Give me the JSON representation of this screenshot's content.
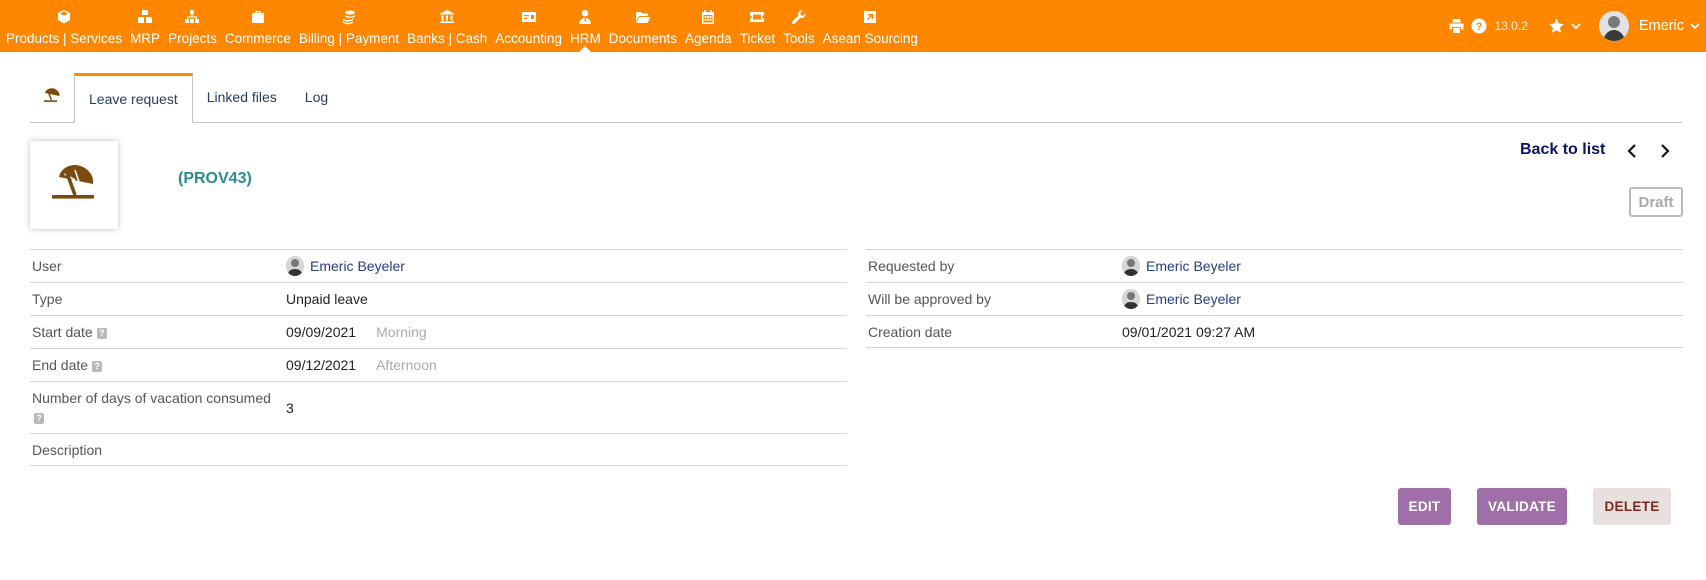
{
  "menu": [
    {
      "label": "Products | Services",
      "icon": "cube-icon"
    },
    {
      "label": "MRP",
      "icon": "cubes-icon"
    },
    {
      "label": "Projects",
      "icon": "sitemap-icon"
    },
    {
      "label": "Commerce",
      "icon": "briefcase-icon"
    },
    {
      "label": "Billing | Payment",
      "icon": "coins-icon"
    },
    {
      "label": "Banks | Cash",
      "icon": "bank-icon"
    },
    {
      "label": "Accounting",
      "icon": "money-check-icon"
    },
    {
      "label": "HRM",
      "icon": "user-tie-icon"
    },
    {
      "label": "Documents",
      "icon": "folder-open-icon"
    },
    {
      "label": "Agenda",
      "icon": "calendar-icon"
    },
    {
      "label": "Ticket",
      "icon": "ticket-icon"
    },
    {
      "label": "Tools",
      "icon": "wrench-icon"
    },
    {
      "label": "Asean Sourcing",
      "icon": "external-link-icon"
    }
  ],
  "active_menu": "HRM",
  "topright": {
    "version": "13.0.2",
    "user_name": "Emeric"
  },
  "tabs": {
    "icon": "beach-umbrella-icon",
    "items": [
      "Leave request",
      "Linked files",
      "Log"
    ],
    "active": "Leave request"
  },
  "header": {
    "ref": "(PROV43)",
    "back_to_list": "Back to list",
    "status": "Draft",
    "logo_icon": "beach-umbrella-icon"
  },
  "left_fields": {
    "user": {
      "label": "User",
      "value": "Emeric Beyeler"
    },
    "type": {
      "label": "Type",
      "value": "Unpaid leave"
    },
    "start_date": {
      "label": "Start date",
      "value": "09/09/2021",
      "half": "Morning"
    },
    "end_date": {
      "label": "End date",
      "value": "09/12/2021",
      "half": "Afternoon"
    },
    "days": {
      "label": "Number of days of vacation consumed",
      "value": "3"
    },
    "description": {
      "label": "Description",
      "value": ""
    }
  },
  "right_fields": {
    "requested_by": {
      "label": "Requested by",
      "value": "Emeric Beyeler"
    },
    "approver": {
      "label": "Will be approved by",
      "value": "Emeric Beyeler"
    },
    "creation_date": {
      "label": "Creation date",
      "value": "09/01/2021 09:27 AM"
    }
  },
  "buttons": {
    "edit": "EDIT",
    "validate": "VALIDATE",
    "delete": "DELETE"
  },
  "colors": {
    "topbar": "#ff8700",
    "ref": "#2a8a97",
    "action_button": "#a06ea8",
    "delete_button": "#e8e0dc"
  }
}
